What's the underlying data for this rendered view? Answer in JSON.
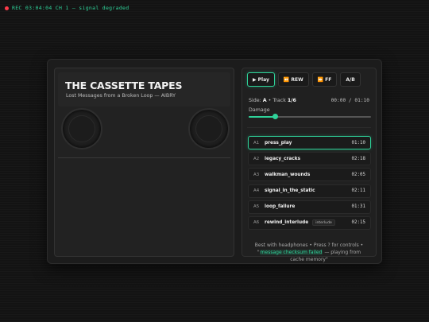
{
  "status": {
    "text": "REC  03:04:04  CH 1 — signal degraded",
    "dot_color": "#ff3b4a",
    "color": "#2fd39a"
  },
  "cassette": {
    "title": "THE CASSETTE TAPES",
    "subtitle": "Lost Messages from a Broken Loop — AIBRY"
  },
  "controls": {
    "play_label": "Play",
    "rew_label": "REW",
    "ff_label": "FF",
    "ab_label": "A/B",
    "play_icon": "play-icon",
    "rew_icon": "rewind-icon",
    "ff_icon": "fast-forward-icon"
  },
  "side_info": {
    "side_label": "Side:",
    "side_value": "A",
    "track_label": "Track",
    "track_value": "1/6",
    "time": "00:00 / 01:10"
  },
  "damage": {
    "label": "Damage",
    "value": 0.22
  },
  "tracks": [
    {
      "code": "A1",
      "name": "press_play",
      "tag": "",
      "duration": "01:10",
      "active": true
    },
    {
      "code": "A2",
      "name": "legacy_cracks",
      "tag": "",
      "duration": "02:18",
      "active": false
    },
    {
      "code": "A3",
      "name": "walkman_wounds",
      "tag": "",
      "duration": "02:05",
      "active": false
    },
    {
      "code": "A4",
      "name": "signal_in_the_static",
      "tag": "",
      "duration": "02:11",
      "active": false
    },
    {
      "code": "A5",
      "name": "loop_failure",
      "tag": "",
      "duration": "01:31",
      "active": false
    },
    {
      "code": "A6",
      "name": "rewind_interlude",
      "tag": "interlude",
      "duration": "02:15",
      "active": false
    }
  ],
  "footer": {
    "line_start": "Best with headphones • Press ? for controls •",
    "quote_open": "\"",
    "highlight": "message checksum failed",
    "line_end": " — playing from cache memory\""
  },
  "accent_color": "#2fd39a"
}
